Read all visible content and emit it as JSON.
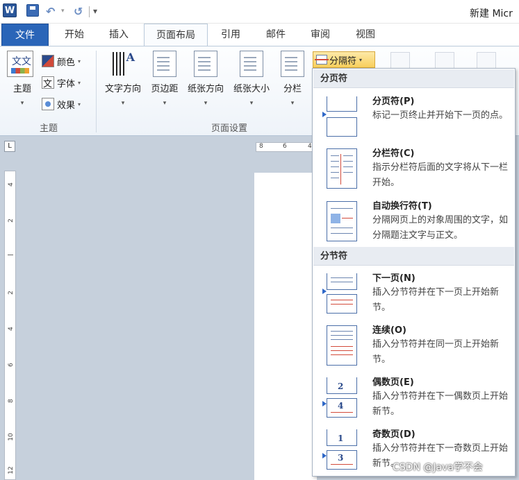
{
  "titlebar": {
    "app_icon": "W",
    "undo_glyph": "↶",
    "redo_glyph": "↺",
    "more_glyph": "▾",
    "title": "新建 Micr"
  },
  "tabs": [
    "文件",
    "开始",
    "插入",
    "页面布局",
    "引用",
    "邮件",
    "审阅",
    "视图"
  ],
  "ribbon": {
    "theme_group": {
      "label": "主题",
      "themes": "主题",
      "theme_icon_text": "文文",
      "colors": "颜色",
      "fonts": "字体",
      "effects": "效果"
    },
    "page_setup_group": {
      "label": "页面设置",
      "text_direction": "文字方向",
      "margins": "页边距",
      "orientation": "纸张方向",
      "size": "纸张大小",
      "columns": "分栏",
      "breaks": "分隔符"
    },
    "dropdown_glyph": "▾"
  },
  "ruler": {
    "corner": "L",
    "h_ticks": [
      "8",
      "6",
      "4"
    ],
    "v_ticks": [
      "4",
      "2",
      "2",
      "4",
      "6",
      "8",
      "10",
      "12"
    ]
  },
  "breaks_menu": {
    "page_breaks_header": "分页符",
    "section_breaks_header": "分节符",
    "items": [
      {
        "title": "分页符(P)",
        "desc": "标记一页终止并开始下一页的点。"
      },
      {
        "title": "分栏符(C)",
        "desc": "指示分栏符后面的文字将从下一栏开始。"
      },
      {
        "title": "自动换行符(T)",
        "desc": "分隔网页上的对象周围的文字，如分隔题注文字与正文。"
      },
      {
        "title": "下一页(N)",
        "desc": "插入分节符并在下一页上开始新节。"
      },
      {
        "title": "连续(O)",
        "desc": "插入分节符并在同一页上开始新节。"
      },
      {
        "title": "偶数页(E)",
        "desc": "插入分节符并在下一偶数页上开始新节。"
      },
      {
        "title": "奇数页(D)",
        "desc": "插入分节符并在下一奇数页上开始新节。"
      }
    ],
    "even_page_numbers": [
      "2",
      "4"
    ],
    "odd_page_numbers": [
      "1",
      "3"
    ]
  },
  "watermark": "CSDN @Java学不会"
}
